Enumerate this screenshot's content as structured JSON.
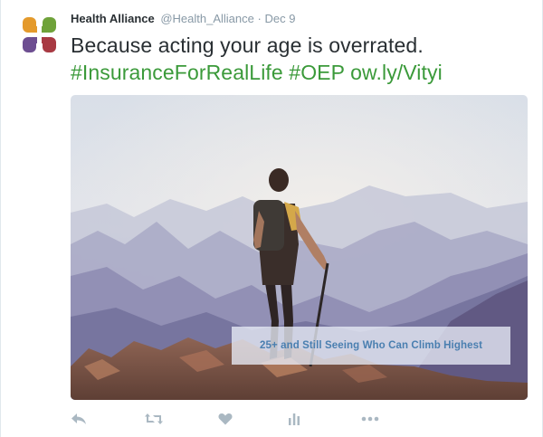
{
  "tweet": {
    "author_name": "Health Alliance",
    "author_handle": "@Health_Alliance",
    "separator": "·",
    "date": "Dec 9",
    "text_line1": "Because acting your age is overrated.",
    "hashtag1": "#InsuranceForRealLife",
    "hashtag2": "#OEP",
    "link": "ow.ly/Vityi",
    "image_caption": "25+ and Still Seeing Who Can Climb Highest"
  },
  "actions": {
    "icons": [
      "reply-icon",
      "retweet-icon",
      "like-icon",
      "analytics-icon",
      "more-icon"
    ]
  },
  "colors": {
    "link": "#3b9a3a",
    "muted": "#8899a6",
    "action_icon": "#aab8c2",
    "logo_orange": "#e49a2c",
    "logo_green": "#6fa23a",
    "logo_purple": "#6d4e91",
    "logo_red": "#a83a43"
  }
}
